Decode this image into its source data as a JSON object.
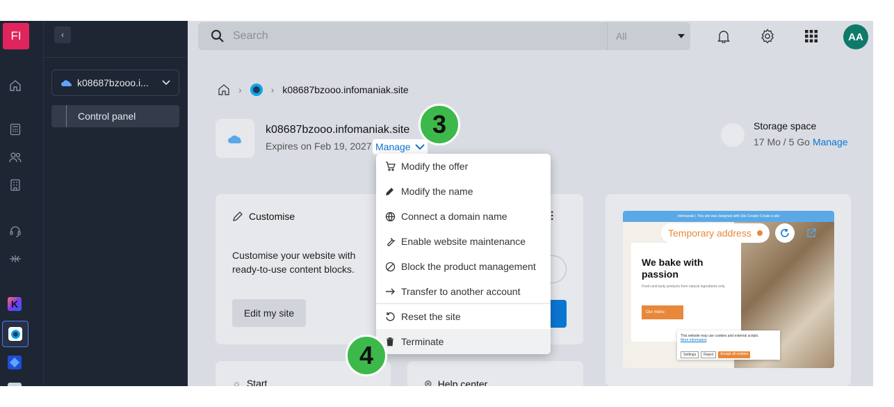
{
  "rail": {
    "badge": "FI",
    "items": [
      "home-icon",
      "calculator-icon",
      "users-icon",
      "building-icon",
      "headset-icon",
      "network-icon"
    ],
    "products": [
      "kchat-product-icon",
      "web-product-icon",
      "cube-product-icon"
    ]
  },
  "sidebar": {
    "product_selector": "k08687bzooo.i...",
    "control_panel": "Control panel"
  },
  "topbar": {
    "search_placeholder": "Search",
    "scope": "All",
    "avatar": "AA"
  },
  "breadcrumb": {
    "current": "k08687bzooo.infomaniak.site"
  },
  "site": {
    "name": "k08687bzooo.infomaniak.site",
    "expires": "Expires on Feb 19, 2027",
    "manage": "Manage"
  },
  "storage": {
    "title": "Storage space",
    "value": "17 Mo / 5 Go",
    "manage": "Manage"
  },
  "customise": {
    "title": "Customise",
    "text": "Customise your website with ready-to-use content blocks.",
    "button": "Edit my site"
  },
  "bottom_cards": {
    "start": "Start",
    "help": "Help center"
  },
  "menu": {
    "items": [
      {
        "label": "Modify the offer",
        "icon": "cart-icon"
      },
      {
        "label": "Modify the name",
        "icon": "pencil-icon"
      },
      {
        "label": "Connect a domain name",
        "icon": "globe-icon"
      },
      {
        "label": "Enable website maintenance",
        "icon": "wrench-icon"
      },
      {
        "label": "Block the product management",
        "icon": "block-icon"
      },
      {
        "label": "Transfer to another account",
        "icon": "arrow-right-icon"
      },
      {
        "label": "Reset the site",
        "icon": "reset-icon"
      },
      {
        "label": "Terminate",
        "icon": "trash-icon"
      }
    ]
  },
  "steps": {
    "a": "3",
    "b": "4"
  },
  "preview": {
    "temp_address": "Temporary address",
    "banner": "infomaniak | This site was designed with Site Creator   Create a site",
    "headline": "We bake with passion",
    "subtext": "Fresh and tasty products from natural ingredients only.",
    "menu_btn": "Our menu",
    "cookie_text": "This website may use cookies and external scripts.",
    "cookie_link": "More information",
    "cookie_settings": "Settings",
    "cookie_reject": "Reject",
    "cookie_accept": "Accept all cookies"
  }
}
